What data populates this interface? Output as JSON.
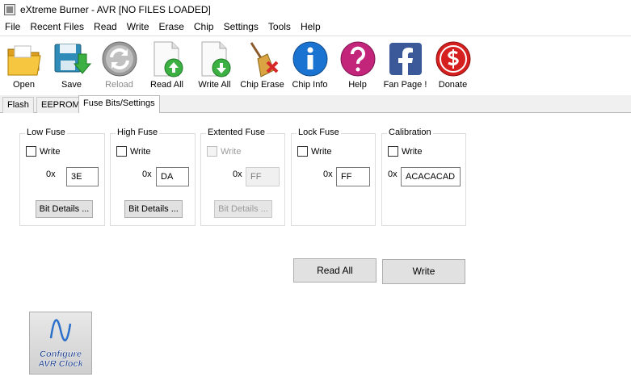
{
  "window": {
    "title": "eXtreme Burner - AVR [NO FILES LOADED]"
  },
  "menu": [
    "File",
    "Recent Files",
    "Read",
    "Write",
    "Erase",
    "Chip",
    "Settings",
    "Tools",
    "Help"
  ],
  "toolbar": {
    "open": "Open",
    "save": "Save",
    "reload": "Reload",
    "read_all": "Read All",
    "write_all": "Write All",
    "chip_erase": "Chip Erase",
    "chip_info": "Chip Info",
    "help": "Help",
    "fan_page": "Fan Page !",
    "donate": "Donate"
  },
  "tabs": [
    "Flash",
    "EEPROM",
    "Fuse Bits/Settings"
  ],
  "active_tab": "Fuse Bits/Settings",
  "fuses": {
    "low": {
      "title": "Low Fuse",
      "write_label": "Write",
      "prefix": "0x",
      "value": "3E",
      "details": "Bit Details ..."
    },
    "high": {
      "title": "High Fuse",
      "write_label": "Write",
      "prefix": "0x",
      "value": "DA",
      "details": "Bit Details ..."
    },
    "extended": {
      "title": "Extented Fuse",
      "write_label": "Write",
      "prefix": "0x",
      "value": "FF",
      "details": "Bit Details ...",
      "disabled": true
    },
    "lock": {
      "title": "Lock Fuse",
      "write_label": "Write",
      "prefix": "0x",
      "value": "FF"
    },
    "calibration": {
      "title": "Calibration",
      "write_label": "Write",
      "prefix": "0x",
      "value": "ACACACAD"
    }
  },
  "actions": {
    "read_all": "Read All",
    "write": "Write"
  },
  "clock_button": {
    "line1": "Configure",
    "line2": "AVR Clock"
  },
  "colors": {
    "tab_active_bg": "#ffffff",
    "button_bg": "#e1e1e1",
    "disabled_text": "#9a9a9a"
  }
}
